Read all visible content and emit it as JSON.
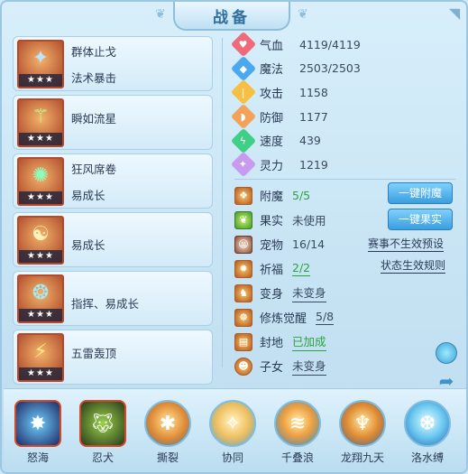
{
  "window": {
    "title": "战备",
    "close_icon": "close-icon"
  },
  "gear": [
    {
      "name": "群体止戈",
      "sub": "法术暴击",
      "stars": "★★★",
      "icon": "gear-icon-1"
    },
    {
      "name": "瞬如流星",
      "sub": "",
      "stars": "★★★",
      "icon": "gear-icon-2"
    },
    {
      "name": "狂风席卷",
      "sub": "易成长",
      "stars": "★★★",
      "icon": "gear-icon-3"
    },
    {
      "name": "",
      "sub": "易成长",
      "stars": "★★★",
      "icon": "gear-icon-4"
    },
    {
      "name": "",
      "sub": "指挥、易成长",
      "stars": "★★★",
      "icon": "gear-icon-5"
    },
    {
      "name": "五雷轰顶",
      "sub": "",
      "stars": "★★★",
      "icon": "gear-icon-6"
    }
  ],
  "stats": [
    {
      "label": "气血",
      "value": "4119/4119",
      "icon": "heart-icon",
      "color": "#f06a7a"
    },
    {
      "label": "魔法",
      "value": "2503/2503",
      "icon": "mana-icon",
      "color": "#4aa8f0"
    },
    {
      "label": "攻击",
      "value": "1158",
      "icon": "attack-icon",
      "color": "#f5c044"
    },
    {
      "label": "防御",
      "value": "1177",
      "icon": "defense-icon",
      "color": "#f2a25a"
    },
    {
      "label": "速度",
      "value": "439",
      "icon": "speed-icon",
      "color": "#3fcf86"
    },
    {
      "label": "灵力",
      "value": "1219",
      "icon": "spirit-icon",
      "color": "#c89af0"
    }
  ],
  "extras": [
    {
      "label": "附魔",
      "value": "5/5"
    },
    {
      "label": "果实",
      "value": "未使用"
    },
    {
      "label": "宠物",
      "value": "16/14"
    },
    {
      "label": "祈福",
      "value": "2/2"
    },
    {
      "label": "变身",
      "value": "未变身"
    },
    {
      "label": "修炼觉醒",
      "value": "5/8"
    },
    {
      "label": "封地",
      "value": "已加成"
    },
    {
      "label": "子女",
      "value": "未变身"
    }
  ],
  "buttons": {
    "enchant": "一键附魔",
    "fruit": "一键果实",
    "preset": "赛事不生效预设",
    "rules": "状态生效规则"
  },
  "skills": [
    {
      "name": "怒海",
      "icon": "vortex-icon"
    },
    {
      "name": "忍犬",
      "icon": "wolf-icon"
    },
    {
      "name": "撕裂",
      "icon": "claw-icon"
    },
    {
      "name": "协同",
      "icon": "light-icon"
    },
    {
      "name": "千叠浪",
      "icon": "wave-icon"
    },
    {
      "name": "龙翔九天",
      "icon": "dragon-icon"
    },
    {
      "name": "洛水缚",
      "icon": "water-icon"
    }
  ]
}
